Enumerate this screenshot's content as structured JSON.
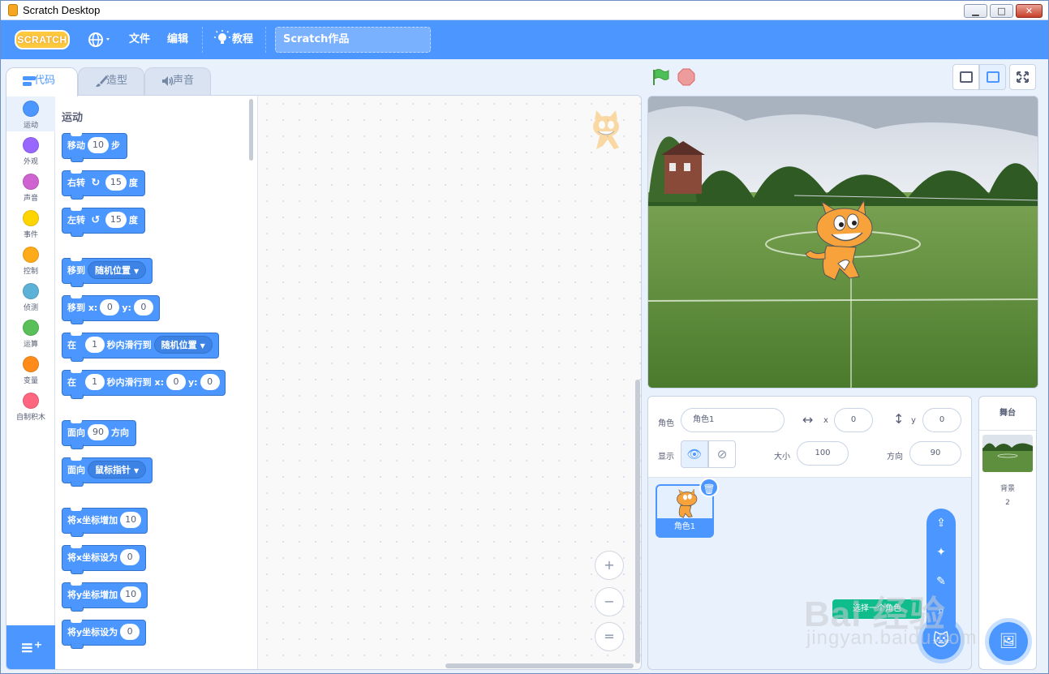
{
  "window": {
    "title": "Scratch Desktop",
    "min": "▁",
    "max": "□",
    "close": "✕"
  },
  "menubar": {
    "logo": "SCRATCH",
    "globe_icon": "globe-icon",
    "file": "文件",
    "edit": "编辑",
    "tutorial": "教程",
    "project_title": "Scratch作品"
  },
  "tabs": {
    "code": "代码",
    "costumes": "造型",
    "sounds": "声音"
  },
  "categories": [
    {
      "label": "运动",
      "color": "#4c97ff"
    },
    {
      "label": "外观",
      "color": "#9966ff"
    },
    {
      "label": "声音",
      "color": "#cf63cf"
    },
    {
      "label": "事件",
      "color": "#ffd500"
    },
    {
      "label": "控制",
      "color": "#ffab19"
    },
    {
      "label": "侦测",
      "color": "#5cb1d6"
    },
    {
      "label": "运算",
      "color": "#59c059"
    },
    {
      "label": "变量",
      "color": "#ff8c1a"
    },
    {
      "label": "自制积木",
      "color": "#ff6680"
    }
  ],
  "palette": {
    "heading": "运动",
    "blocks": {
      "move": {
        "a": "移动",
        "n": "10",
        "b": "步"
      },
      "turn_right": {
        "a": "右转",
        "n": "15",
        "b": "度"
      },
      "turn_left": {
        "a": "左转",
        "n": "15",
        "b": "度"
      },
      "goto": {
        "a": "移到",
        "d": "随机位置"
      },
      "goto_xy": {
        "a": "移到 x:",
        "x": "0",
        "b": "y:",
        "y": "0"
      },
      "glide": {
        "a": "在",
        "n": "1",
        "b": "秒内滑行到",
        "d": "随机位置"
      },
      "glide_xy": {
        "a": "在",
        "n": "1",
        "b": "秒内滑行到 x:",
        "x": "0",
        "c": "y:",
        "y": "0"
      },
      "point_dir": {
        "a": "面向",
        "n": "90",
        "b": "方向"
      },
      "point_towards": {
        "a": "面向",
        "d": "鼠标指针"
      },
      "change_x": {
        "a": "将x坐标增加",
        "n": "10"
      },
      "set_x": {
        "a": "将x坐标设为",
        "n": "0"
      },
      "change_y": {
        "a": "将y坐标增加",
        "n": "10"
      },
      "set_y": {
        "a": "将y坐标设为",
        "n": "0"
      }
    }
  },
  "zoom": {
    "in": "+",
    "out": "−",
    "reset": "="
  },
  "sprite_info": {
    "sprite_label": "角色",
    "sprite_name": "角色1",
    "x_label": "x",
    "x_value": "0",
    "y_label": "y",
    "y_value": "0",
    "show_label": "显示",
    "size_label": "大小",
    "size_value": "100",
    "direction_label": "方向",
    "direction_value": "90"
  },
  "sprites": [
    {
      "name": "角色1"
    }
  ],
  "add_sprite_tooltip": "选择一个角色",
  "stage_panel": {
    "heading": "舞台",
    "backdrops_label": "背景",
    "backdrops_count": "2"
  },
  "watermark": {
    "line1": "Bai 经验",
    "line2": "jingyan.baidu.com"
  }
}
